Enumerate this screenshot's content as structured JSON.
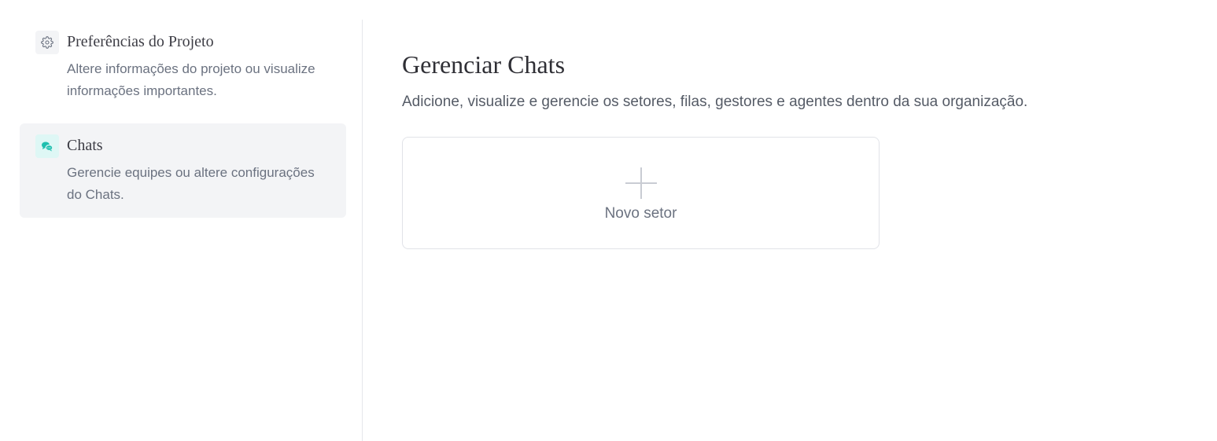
{
  "sidebar": {
    "items": [
      {
        "title": "Preferências do Projeto",
        "description": "Altere informações do projeto ou visualize informações importantes.",
        "icon": "gear-icon",
        "active": false
      },
      {
        "title": "Chats",
        "description": "Gerencie equipes ou altere configurações do Chats.",
        "icon": "chat-bubbles-icon",
        "active": true
      }
    ]
  },
  "main": {
    "title": "Gerenciar Chats",
    "subtitle": "Adicione, visualize e gerencie os setores, filas, gestores e agentes dentro da sua organização.",
    "new_sector_label": "Novo setor"
  },
  "colors": {
    "accent": "#1ebfae",
    "active_bg": "#f3f4f6",
    "border": "#e1e3e8"
  }
}
